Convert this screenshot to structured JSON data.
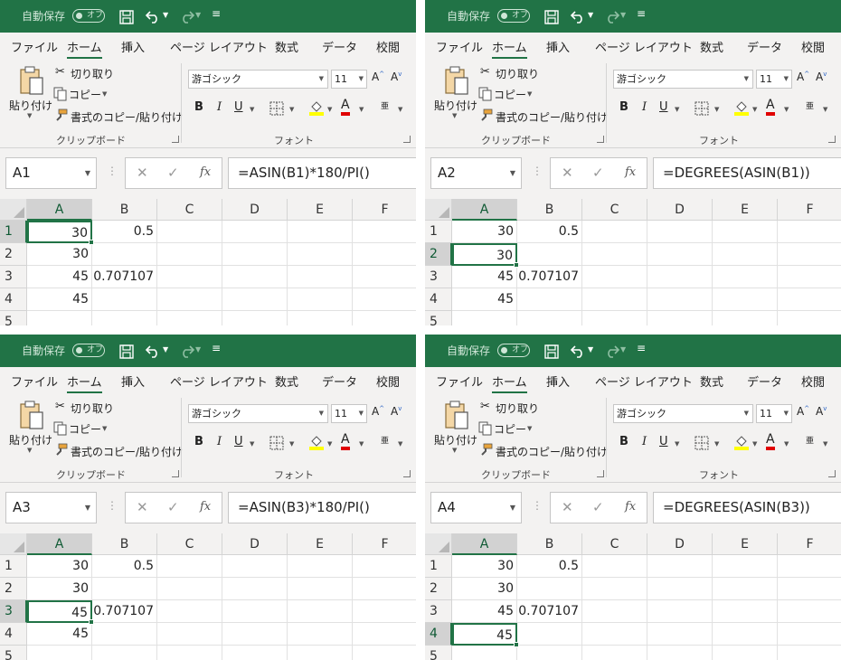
{
  "app": {
    "autosave_label": "自動保存",
    "autosave_toggle": "オフ",
    "tabs": [
      "ファイル",
      "ホーム",
      "挿入",
      "ページ レイアウト",
      "数式",
      "データ",
      "校閲"
    ],
    "active_tab": "ホーム",
    "clipboard": {
      "paste": "貼り付け",
      "cut": "切り取り",
      "copy": "コピー",
      "format_painter": "書式のコピー/貼り付け",
      "group_label": "クリップボード"
    },
    "font": {
      "name": "游ゴシック",
      "size": "11",
      "bold": "B",
      "italic": "I",
      "underline": "U",
      "grow": "A",
      "shrink": "A",
      "phonetic": "亜",
      "group_label": "フォント"
    },
    "formula_bar": {
      "cancel": "✕",
      "enter": "✓",
      "fx": "fx"
    },
    "columns": [
      "A",
      "B",
      "C",
      "D",
      "E",
      "F"
    ],
    "rows": [
      "1",
      "2",
      "3",
      "4",
      "5"
    ],
    "cells": [
      [
        "30",
        "0.5",
        "",
        "",
        "",
        ""
      ],
      [
        "30",
        "",
        "",
        "",
        "",
        ""
      ],
      [
        "45",
        "0.707107",
        "",
        "",
        "",
        ""
      ],
      [
        "45",
        "",
        "",
        "",
        "",
        ""
      ],
      [
        "",
        "",
        "",
        "",
        "",
        ""
      ]
    ],
    "colors": {
      "brand_green": "#217346",
      "highlight_yellow": "#ffff00",
      "font_red": "#e00000"
    }
  },
  "panels": [
    {
      "name_box": "A1",
      "formula": "=ASIN(B1)*180/PI()",
      "selected_row": 0
    },
    {
      "name_box": "A2",
      "formula": "=DEGREES(ASIN(B1))",
      "selected_row": 1
    },
    {
      "name_box": "A3",
      "formula": "=ASIN(B3)*180/PI()",
      "selected_row": 2
    },
    {
      "name_box": "A4",
      "formula": "=DEGREES(ASIN(B3))",
      "selected_row": 3
    }
  ]
}
